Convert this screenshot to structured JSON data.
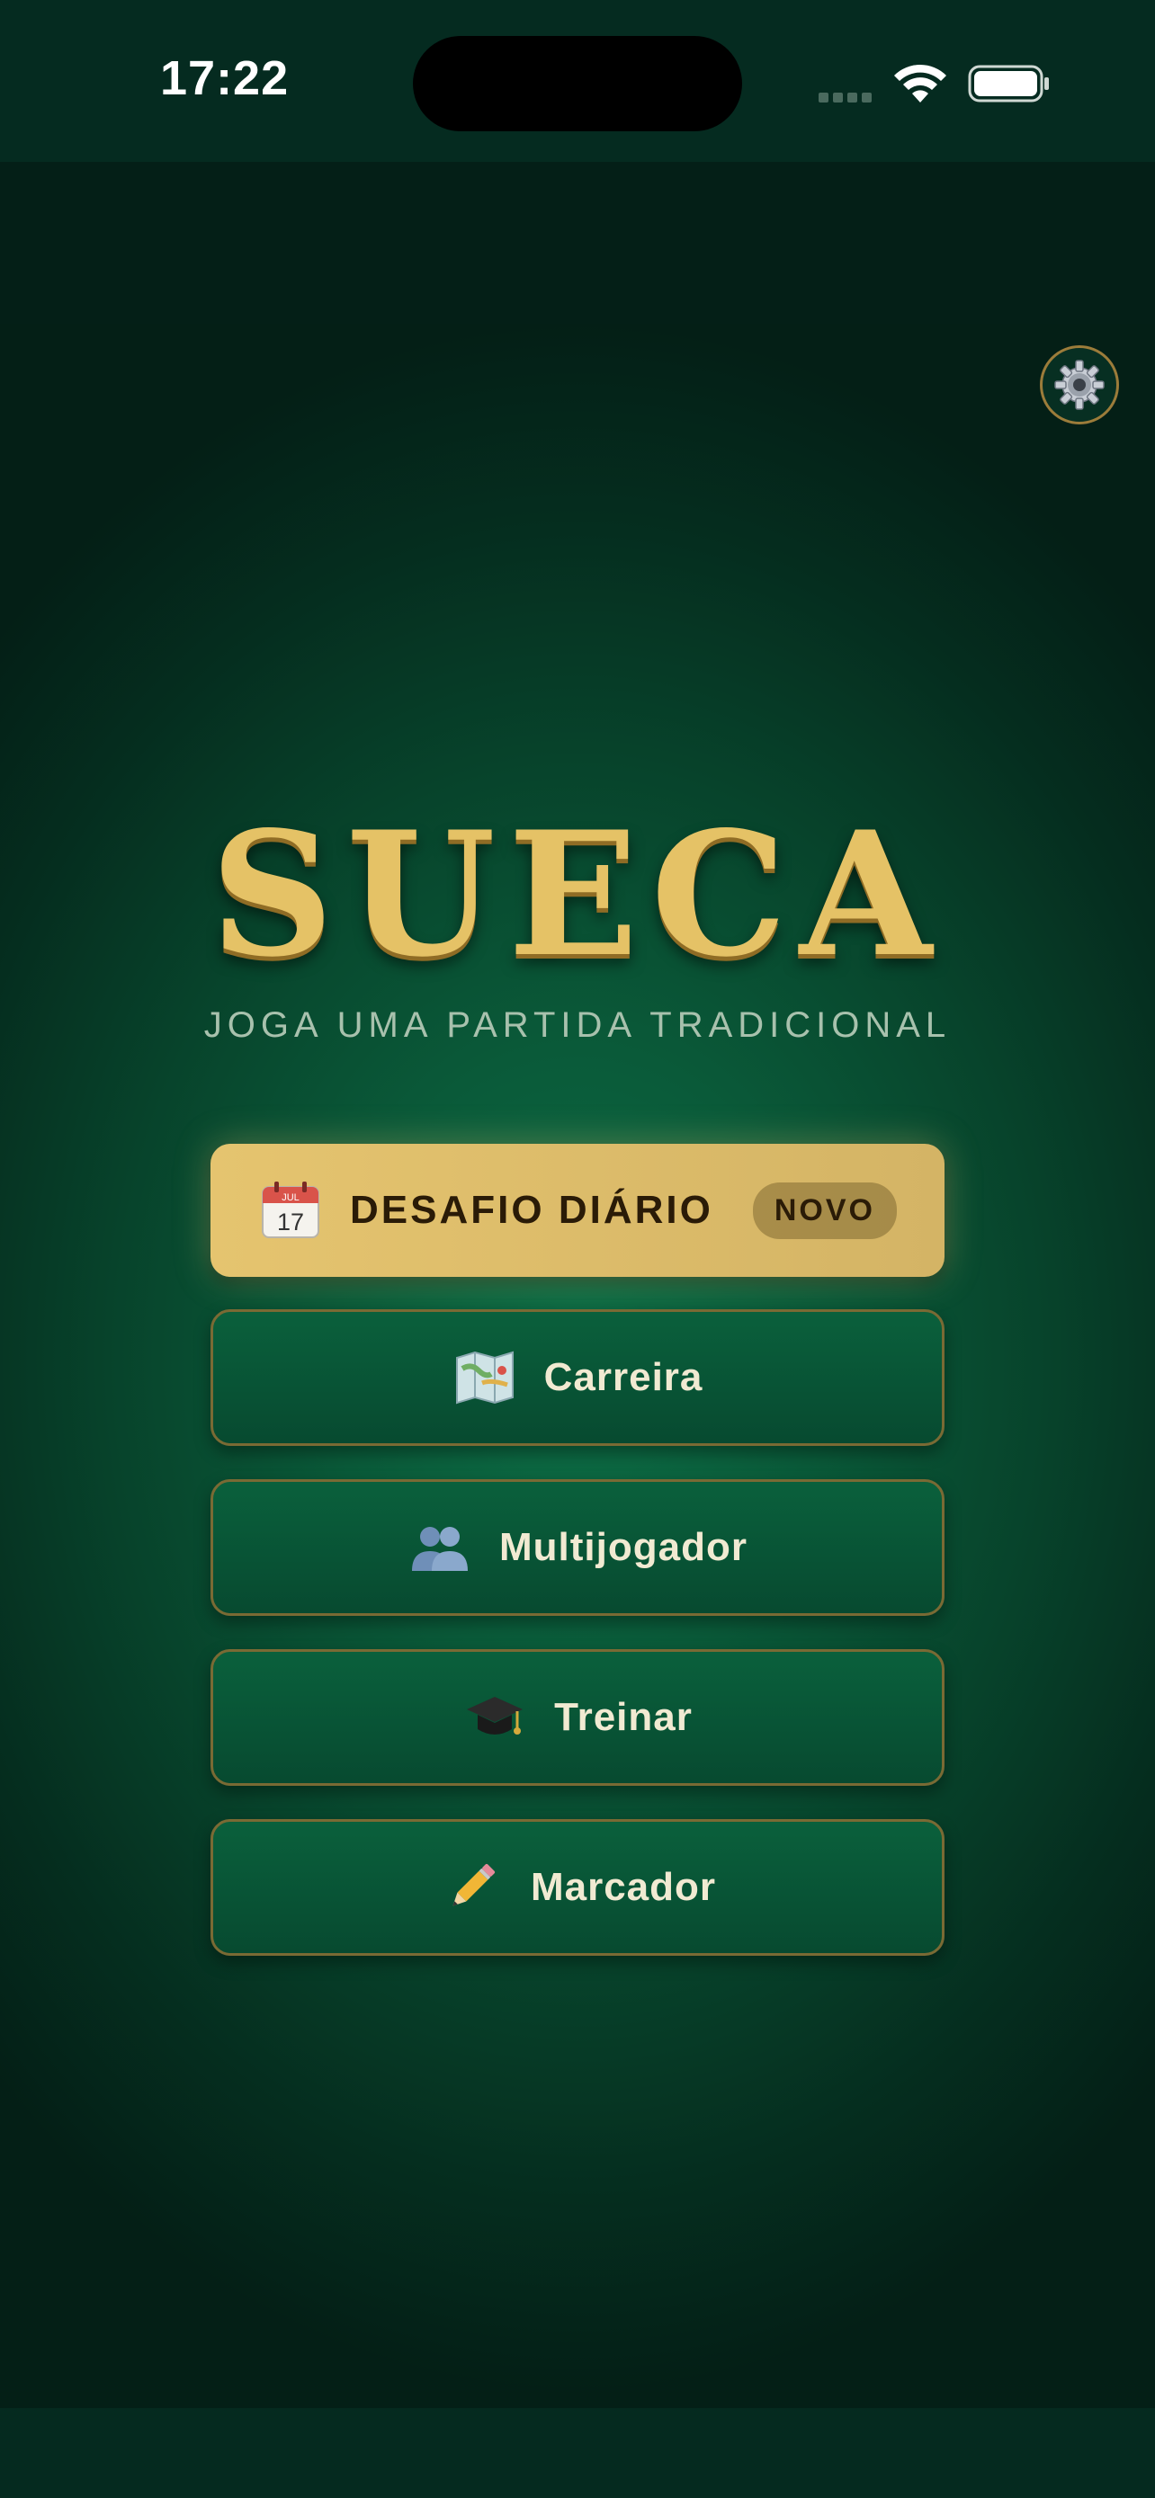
{
  "status_bar": {
    "time": "17:22"
  },
  "app": {
    "title": "SUECA",
    "subtitle": "JOGA UMA PARTIDA TRADICIONAL"
  },
  "settings": {
    "icon": "gear-icon"
  },
  "menu": {
    "daily": {
      "icon": "calendar-icon",
      "label": "DESAFIO DIÁRIO",
      "badge": "NOVO"
    },
    "career": {
      "icon": "map-icon",
      "label": "Carreira"
    },
    "multiplayer": {
      "icon": "users-icon",
      "label": "Multijogador"
    },
    "train": {
      "icon": "graduation-cap-icon",
      "label": "Treinar"
    },
    "scorer": {
      "icon": "pencil-icon",
      "label": "Marcador"
    }
  },
  "colors": {
    "accent_gold": "#e5c266",
    "background_green": "#0a5a39",
    "outline_gold": "#7a6a34"
  }
}
